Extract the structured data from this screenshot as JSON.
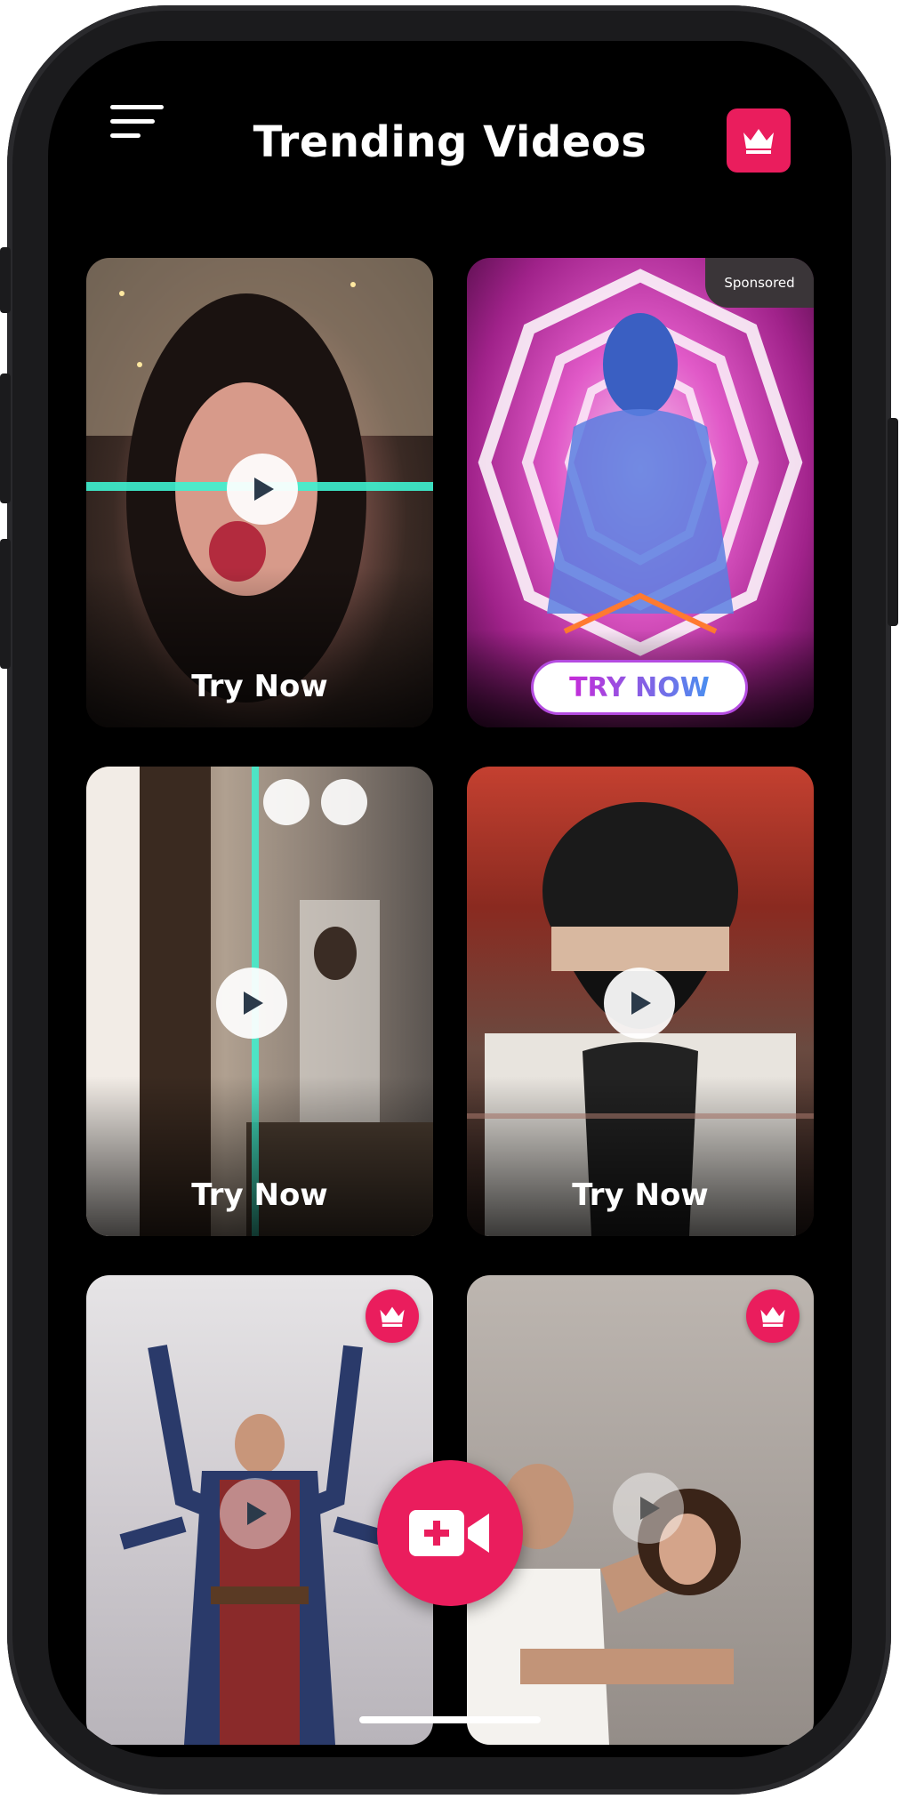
{
  "header": {
    "title": "Trending Videos",
    "menu_icon": "hamburger-icon",
    "premium_icon": "crown-icon"
  },
  "cards": [
    {
      "label": "Try Now",
      "style": "text",
      "sponsored": false,
      "premium": false
    },
    {
      "label": "TRY NOW",
      "style": "pill",
      "sponsored": true,
      "sponsored_label": "Sponsored",
      "premium": false
    },
    {
      "label": "Try Now",
      "style": "text",
      "sponsored": false,
      "premium": false
    },
    {
      "label": "Try Now",
      "style": "text",
      "sponsored": false,
      "premium": false
    },
    {
      "label": "",
      "style": "none",
      "sponsored": false,
      "premium": true
    },
    {
      "label": "",
      "style": "none",
      "sponsored": false,
      "premium": true
    }
  ],
  "fab": {
    "icon": "add-video-icon"
  },
  "colors": {
    "accent": "#ea1d5d",
    "background": "#000000",
    "pill_gradient_start": "#c62bd8",
    "pill_gradient_end": "#4a8ff0"
  }
}
